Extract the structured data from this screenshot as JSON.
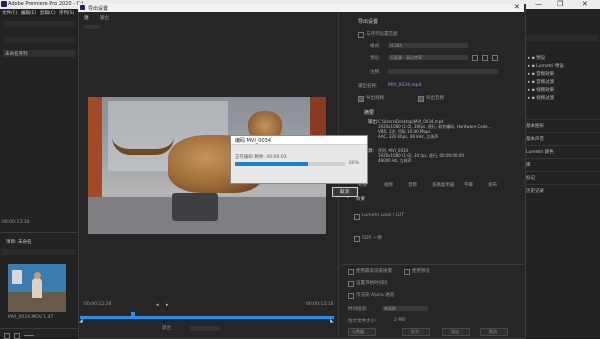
{
  "app": {
    "title": "Adobe Premiere Pro 2020 - C:\\...",
    "menu": [
      "文件(F)",
      "编辑(E)",
      "剪辑(C)",
      "序列(S)"
    ],
    "window_controls": [
      "—",
      "❐",
      "✕"
    ]
  },
  "left_panel": {
    "project_name": "",
    "items": [
      "未命名序列"
    ],
    "timecode": "00:00:13:16",
    "tab": "项目: 未命名",
    "thumb_caption": "MVI_0034.MOV 1.47"
  },
  "export_dialog": {
    "title": "导出设置",
    "source_tab": "源",
    "output_tab": "输出",
    "timeline_start": "00;00;12;28",
    "timeline_end": "00;00;13;16",
    "settings": {
      "heading": "导出设置",
      "match_sequence": "与序列设置匹配",
      "format_label": "格式:",
      "format_value": "H.264",
      "preset_label": "预设:",
      "preset_value": "匹配源 - 高比特率",
      "comment_label": "注释:",
      "output_name_label": "输出名称:",
      "output_name_value": "MVI_0034.mp4",
      "export_video": "导出视频",
      "export_audio": "导出音频",
      "summary_heading": "摘要",
      "summary_output_label": "输出:",
      "summary_output": [
        "C:\\Users\\Desktop\\MVI_0034.mp4",
        "1920x1080 (1.0), 30fps, 逐行, 软件编码, Hardware Code...",
        "VBR, 1次, 目标 10.00 Mbps",
        "AAC, 320 kbps, 48 kHz, 立体声"
      ],
      "summary_source_label": "源:",
      "summary_source": [
        "序列, MVI_0034",
        "1920x1080 (1.0), 30 fps, 逐行, 00:00:00:00",
        "48000 Hz, 立体声"
      ],
      "tabs": [
        "效果",
        "视频",
        "音频",
        "多路复用器",
        "字幕",
        "发布"
      ],
      "section_effects": "效果",
      "section_lumetri": "Lumetri Look / LUT",
      "section_sdr": "SDR 一致",
      "use_max_render": "使用最高渲染质量",
      "use_previews": "使用预览",
      "set_start_timecode": "设置开始时间码",
      "render_alpha": "仅渲染 Alpha 通道",
      "time_interp_label": "时间插值:",
      "time_interp_value": "帧采样",
      "file_size_label": "估计文件大小:",
      "file_size_value": "2 MB",
      "btn_metadata": "元数据...",
      "btn_queue": "队列",
      "btn_export": "导出",
      "btn_cancel": "取消"
    },
    "scale_label": "适合",
    "cancel_side": "取消"
  },
  "progress_dialog": {
    "title": "编码 MVI_0034",
    "status": "正在编码 剩余: 00:00:03",
    "percent": "66%",
    "progress": 0.66
  },
  "right_panel": {
    "tabs": [
      "效果",
      "标记",
      "历史记录"
    ],
    "tree": [
      "预设",
      "Lumetri 预设",
      "音频效果",
      "音频过渡",
      "视频效果",
      "视频过渡"
    ],
    "items": [
      "基本图形",
      "基本声音",
      "Lumetri 颜色",
      "库",
      "标记",
      "历史记录"
    ]
  },
  "colors": {
    "accent": "#2d8ceb",
    "progress_fill": "#1f7fd1",
    "title_bar": "#ececec"
  }
}
